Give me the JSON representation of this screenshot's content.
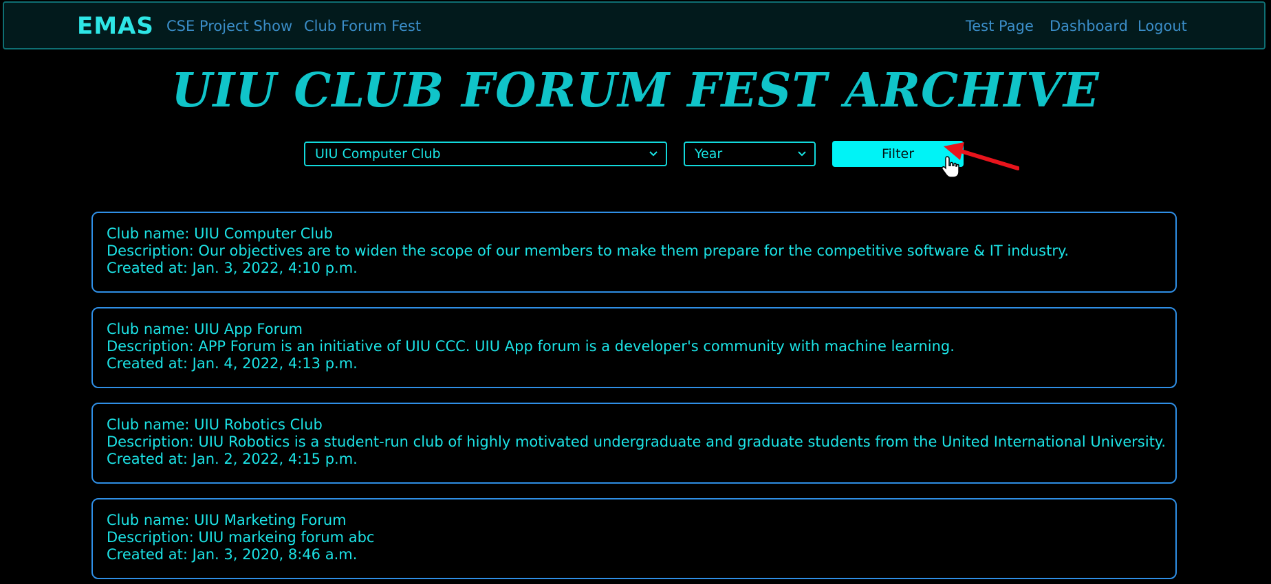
{
  "navbar": {
    "brand": "EMAS",
    "left_links": [
      "CSE Project Show",
      "Club Forum Fest"
    ],
    "right_links": [
      "Test Page",
      "Dashboard",
      "Logout"
    ]
  },
  "page_title": "UIU CLUB FORUM FEST ARCHIVE",
  "filters": {
    "club_select_value": "UIU Computer Club",
    "year_select_value": "Year",
    "filter_button": "Filter"
  },
  "clubs": [
    {
      "name_line": "Club name: UIU Computer Club",
      "description_line": "Description: Our objectives are to widen the scope of our members to make them prepare for the competitive software & IT industry.",
      "created_line": "Created at: Jan. 3, 2022, 4:10 p.m."
    },
    {
      "name_line": "Club name: UIU App Forum",
      "description_line": "Description: APP Forum is an initiative of UIU CCC. UIU App forum is a developer's community with machine learning.",
      "created_line": "Created at: Jan. 4, 2022, 4:13 p.m."
    },
    {
      "name_line": "Club name: UIU Robotics Club",
      "description_line": "Description: UIU Robotics is a student-run club of highly motivated undergraduate and graduate students from the United International University.",
      "created_line": "Created at: Jan. 2, 2022, 4:15 p.m."
    },
    {
      "name_line": "Club name: UIU Marketing Forum",
      "description_line": "Description: UIU markeing forum abc",
      "created_line": "Created at: Jan. 3, 2020, 8:46 a.m."
    }
  ],
  "colors": {
    "background": "#000000",
    "accent_cyan": "#00f3f6",
    "card_border": "#2f8fe6",
    "nav_link": "#3b8ec9",
    "annotation_arrow": "#e8141c"
  },
  "icons": {
    "select_chevron": "chevron-down-icon",
    "mouse_cursor": "hand-pointer-icon",
    "annotation": "red-arrow-icon"
  }
}
